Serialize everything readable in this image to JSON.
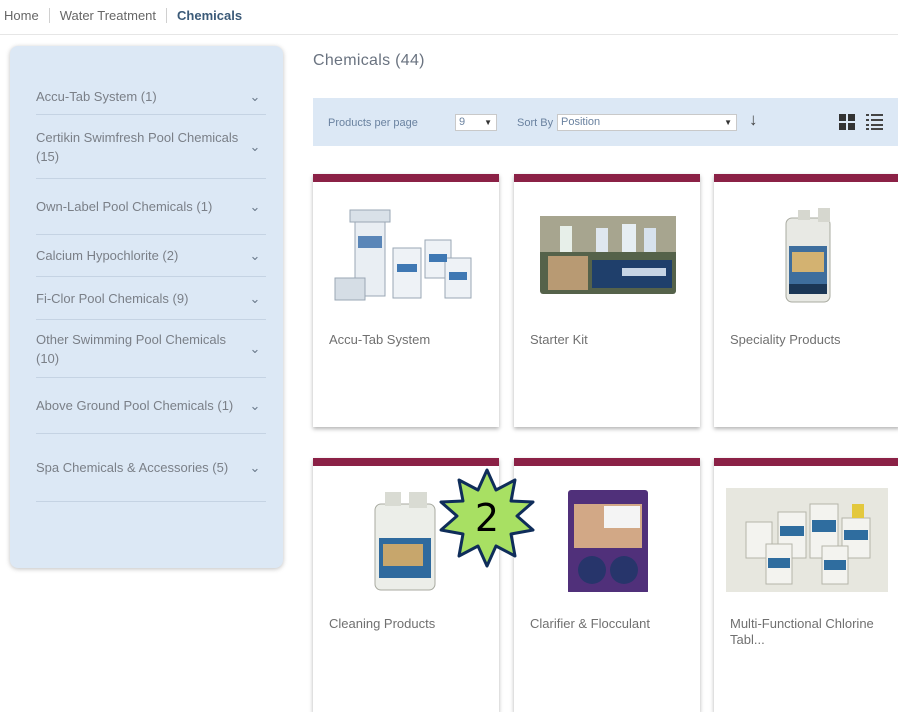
{
  "breadcrumb": {
    "home": "Home",
    "section": "Water Treatment",
    "current": "Chemicals"
  },
  "sidebar": {
    "items": [
      {
        "label": "Accu-Tab System (1)"
      },
      {
        "label": "Certikin Swimfresh Pool Chemicals (15)"
      },
      {
        "label": "Own-Label Pool Chemicals (1)"
      },
      {
        "label": "Calcium Hypochlorite (2)"
      },
      {
        "label": "Fi-Clor Pool Chemicals (9)"
      },
      {
        "label": "Other Swimming Pool Chemicals (10)"
      },
      {
        "label": "Above Ground Pool Chemicals (1)"
      },
      {
        "label": "Spa Chemicals & Accessories (5)"
      }
    ]
  },
  "main": {
    "heading": "Chemicals (44)",
    "toolbar": {
      "per_page_label": "Products per page",
      "per_page_value": "9",
      "sort_label": "Sort By",
      "sort_value": "Position"
    },
    "products": [
      {
        "name": "Accu-Tab System"
      },
      {
        "name": "Starter Kit"
      },
      {
        "name": "Speciality Products"
      },
      {
        "name": "Cleaning Products"
      },
      {
        "name": "Clarifier & Flocculant"
      },
      {
        "name": "Multi-Functional Chlorine Tabl..."
      }
    ]
  },
  "badge": {
    "number": "2",
    "color": "#a8e063"
  },
  "colors": {
    "accent": "#8b2146",
    "panel": "#dce8f5"
  }
}
